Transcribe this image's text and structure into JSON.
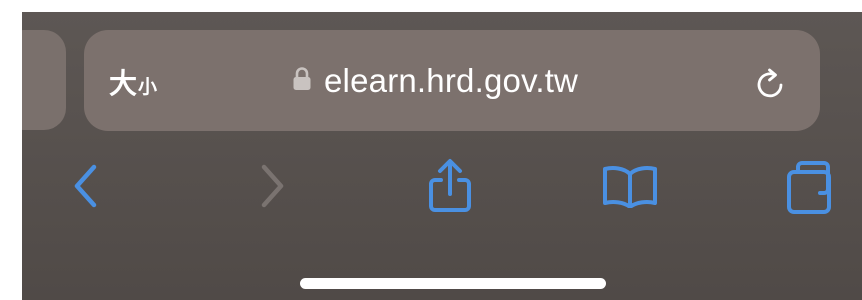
{
  "address_bar": {
    "text_size_big": "大",
    "text_size_small": "小",
    "url": "elearn.hrd.gov.tw",
    "lock_icon": "lock-icon",
    "reload_icon": "reload-icon"
  },
  "toolbar": {
    "back_icon": "chevron-left-icon",
    "forward_icon": "chevron-right-icon",
    "share_icon": "share-icon",
    "bookmarks_icon": "book-icon",
    "tabs_icon": "tabs-icon"
  },
  "colors": {
    "accent": "#4a90e2",
    "disabled": "#7a7370",
    "text": "#ffffff",
    "bar_background": "#7c716d",
    "screen_background": "#58524f"
  }
}
